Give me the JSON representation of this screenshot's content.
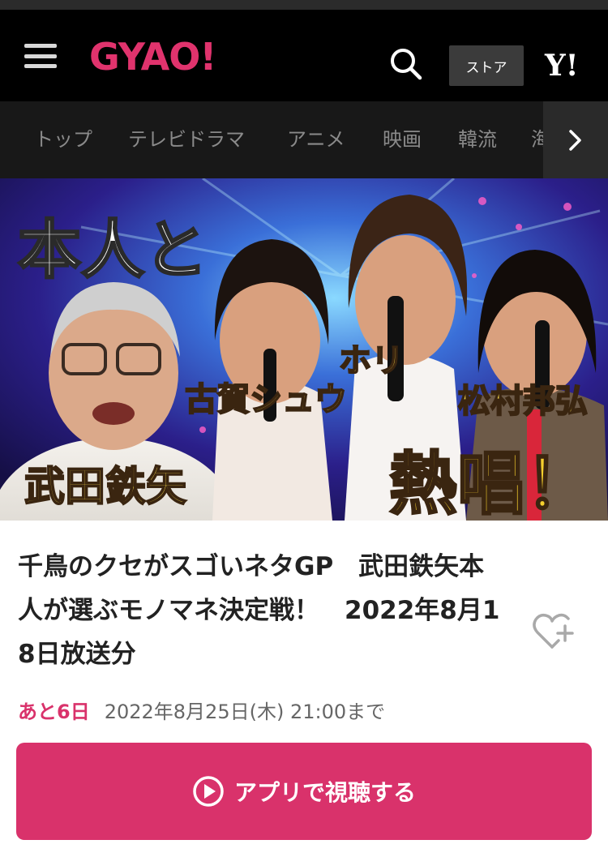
{
  "header": {
    "logo_text": "GYAO!",
    "store_label": "ストア",
    "yahoo_logo_text": "Y!",
    "brand_color": "#e0336d"
  },
  "nav": {
    "items": [
      {
        "label": "トップ"
      },
      {
        "label": "テレビドラマ"
      },
      {
        "label": "アニメ"
      },
      {
        "label": "映画"
      },
      {
        "label": "韓流"
      },
      {
        "label": "海"
      }
    ]
  },
  "thumbnail": {
    "captions": {
      "top_left": "本人と",
      "name_1": "武田鉄矢",
      "name_2": "古賀シュウ",
      "name_3": "ホリ",
      "name_4": "松村邦弘",
      "bottom_right": "熱唱！"
    }
  },
  "program": {
    "title": "千鳥のクセがスゴいネタGP　武田鉄矢本人が選ぶモノマネ決定戦！　2022年8月18日放送分",
    "remaining": "あと6日",
    "available_until": "2022年8月25日(木) 21:00まで",
    "watch_button_label": "アプリで視聴する",
    "accent_color": "#d9326b"
  }
}
